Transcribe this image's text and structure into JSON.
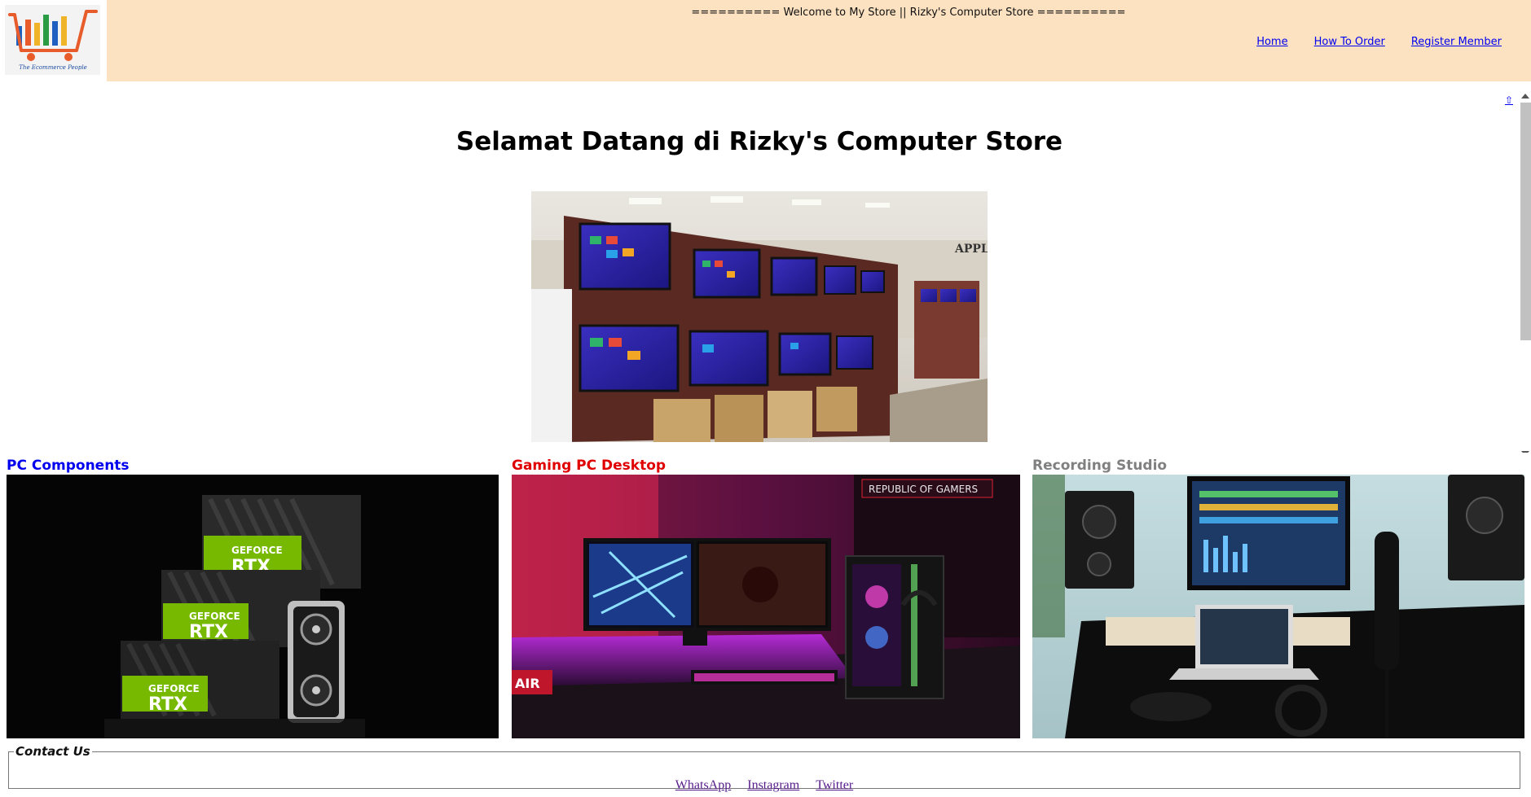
{
  "header": {
    "logo": {
      "icon": "shopping-cart-icon",
      "tagline": "The Ecommerce People"
    },
    "welcome_text": "========== Welcome to My Store || Rizky's Computer Store ==========",
    "nav": [
      {
        "label": "Home"
      },
      {
        "label": "How To Order"
      },
      {
        "label": "Register Member"
      }
    ]
  },
  "main": {
    "title": "Selamat Datang di Rizky's Computer Store",
    "top_link_glyph": "⇧",
    "hero_image": "computer-store-monitors-photo"
  },
  "categories": [
    {
      "label": "PC Components",
      "color": "#0000ee",
      "image": "rtx-graphics-cards-photo"
    },
    {
      "label": "Gaming PC Desktop",
      "color": "#e00000",
      "image": "gaming-pc-setup-photo"
    },
    {
      "label": "Recording Studio",
      "color": "#808080",
      "image": "recording-studio-photo"
    }
  ],
  "contact": {
    "legend": "Contact Us",
    "links": [
      {
        "label": "WhatsApp"
      },
      {
        "label": "Instagram"
      },
      {
        "label": "Twitter"
      }
    ]
  },
  "colors": {
    "header_bg": "#fde2c1",
    "link": "#0000ee",
    "visited_link": "#551a8b"
  }
}
